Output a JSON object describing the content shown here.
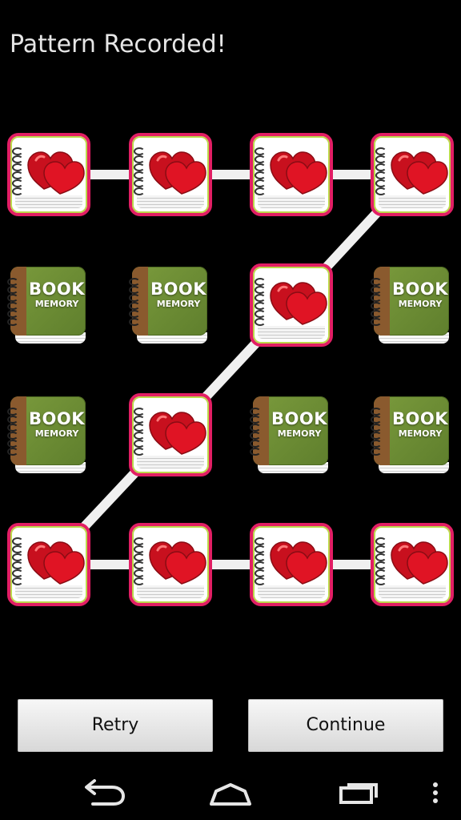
{
  "header": {
    "title": "Pattern Recorded!"
  },
  "tiles": {
    "book_text_1": "BOOK",
    "book_text_2": "MEMORY"
  },
  "grid": {
    "selected": [
      [
        true,
        true,
        true,
        true
      ],
      [
        false,
        false,
        true,
        false
      ],
      [
        false,
        true,
        false,
        false
      ],
      [
        true,
        true,
        true,
        true
      ]
    ]
  },
  "buttons": {
    "retry_label": "Retry",
    "continue_label": "Continue"
  },
  "icons": {
    "back": "back-icon",
    "home": "home-icon",
    "recents": "recents-icon",
    "menu": "overflow-menu-icon",
    "selected_tile": "hearts-notebook-icon",
    "unselected_tile": "book-memory-icon"
  },
  "colors": {
    "background": "#000000",
    "accent": "#e21e64",
    "connector": "#f0f0f0",
    "book_green": "#6b8b35"
  }
}
